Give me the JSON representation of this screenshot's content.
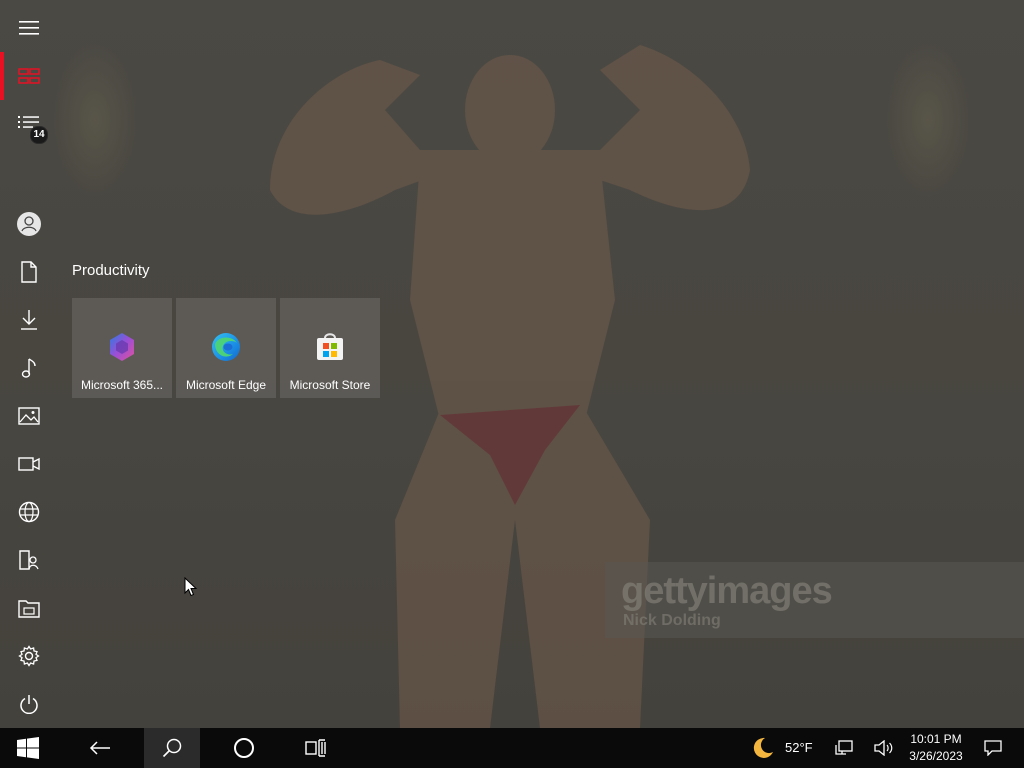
{
  "start_menu": {
    "rail": {
      "expand_label": "Expand",
      "tasks_badge": "14"
    },
    "group_title": "Productivity",
    "tiles": [
      {
        "label": "Microsoft 365...",
        "icon": "microsoft-365-icon"
      },
      {
        "label": "Microsoft Edge",
        "icon": "edge-icon"
      },
      {
        "label": "Microsoft Store",
        "icon": "store-icon"
      }
    ]
  },
  "wallpaper": {
    "watermark_brand": "gettyimages",
    "watermark_credit": "Nick Dolding"
  },
  "taskbar": {
    "weather_temp": "52°F",
    "time": "10:01 PM",
    "date": "3/26/2023"
  },
  "colors": {
    "accent": "#e81123",
    "taskbar": "#0a0a0a"
  }
}
